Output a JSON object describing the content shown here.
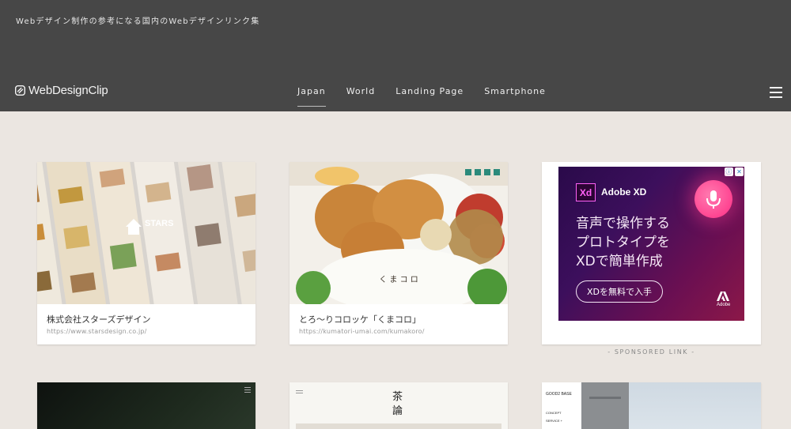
{
  "header": {
    "tagline": "Webデザイン制作の参考になる国内のWebデザインリンク集",
    "logo_text": "WebDesignClip",
    "nav": [
      {
        "label": "Japan",
        "active": true
      },
      {
        "label": "World",
        "active": false
      },
      {
        "label": "Landing Page",
        "active": false
      },
      {
        "label": "Smartphone",
        "active": false
      }
    ],
    "menu_icon": "hamburger-icon"
  },
  "cards": [
    {
      "title": "株式会社スターズデザイン",
      "url": "https://www.starsdesign.co.jp/",
      "thumb_logo": "STARS"
    },
    {
      "title": "とろ〜りコロッケ「くまコロ」",
      "url": "https://kumatori-umai.com/kumakoro/"
    }
  ],
  "ad": {
    "product_badge": "Xd",
    "product_name": "Adobe XD",
    "headline": [
      "音声で操作する",
      "プロトタイプを",
      "XDで簡単作成"
    ],
    "cta": "XDを無料で入手",
    "brand": "Adobe",
    "info_icons": [
      "ⓘ",
      "✕"
    ],
    "sponsored_label": "- SPONSORED LINK -"
  },
  "colors": {
    "header_bg": "#474747",
    "page_bg": "#ebe6e1",
    "card_bg": "#ffffff",
    "ad_accent": "#ff61f6"
  }
}
